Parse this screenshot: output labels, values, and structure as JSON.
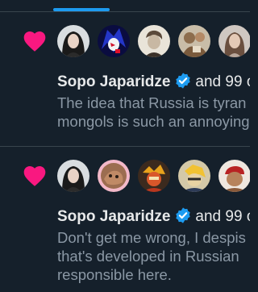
{
  "notifications": [
    {
      "author": "Sopo Japaridze",
      "suffix": "and 99 o",
      "text": "The idea that Russia is tyran\nmongols is such an annoying",
      "avatars": [
        "avatar-dark-hair-woman",
        "avatar-anime-blue-hair",
        "avatar-sepia-portrait",
        "avatar-painting",
        "avatar-long-hair-woman"
      ]
    },
    {
      "author": "Sopo Japaridze",
      "suffix": "and 99 o",
      "text": "Don't get me wrong, I despis\nthat's developed in Russian\nresponsible here.",
      "avatars": [
        "avatar-dark-hair-woman",
        "avatar-cat-pink-ring",
        "avatar-cartoon-orange",
        "avatar-cartoon-yellow",
        "avatar-red-cap-man"
      ]
    }
  ],
  "colors": {
    "background": "#15202b",
    "like": "#f91880",
    "verified": "#1d9bf0",
    "primary_text": "#e7e9ea",
    "secondary_text": "#8b98a5"
  }
}
